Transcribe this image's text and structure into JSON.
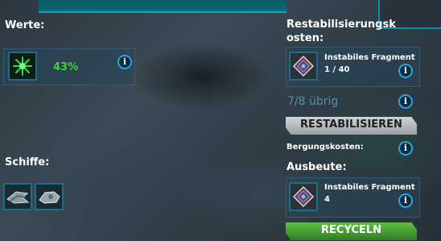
{
  "left": {
    "values_label": "Werte:",
    "percent": "43%",
    "ships_label": "Schiffe:",
    "ship_icons": [
      "ship-a-icon",
      "ship-b-icon"
    ]
  },
  "right": {
    "restab_cost_label_line1": "Restabilisierungsk",
    "restab_cost_label_line2": "osten:",
    "cost_item": {
      "name": "Instabiles Fragment",
      "count": "1 / 40"
    },
    "remaining": "7/8 übrig",
    "restab_button": "RESTABILISIEREN",
    "salvage_cost_label": "Bergungskosten:",
    "yield_label": "Ausbeute:",
    "yield_item": {
      "name": "Instabiles Fragment",
      "count": "4"
    },
    "recycle_button": "RECYCELN"
  },
  "colors": {
    "accent": "#2fa3e0",
    "percent_text": "#3cd43c",
    "remaining_text": "#5a8fb0",
    "button_green": "#3f9a2c"
  }
}
